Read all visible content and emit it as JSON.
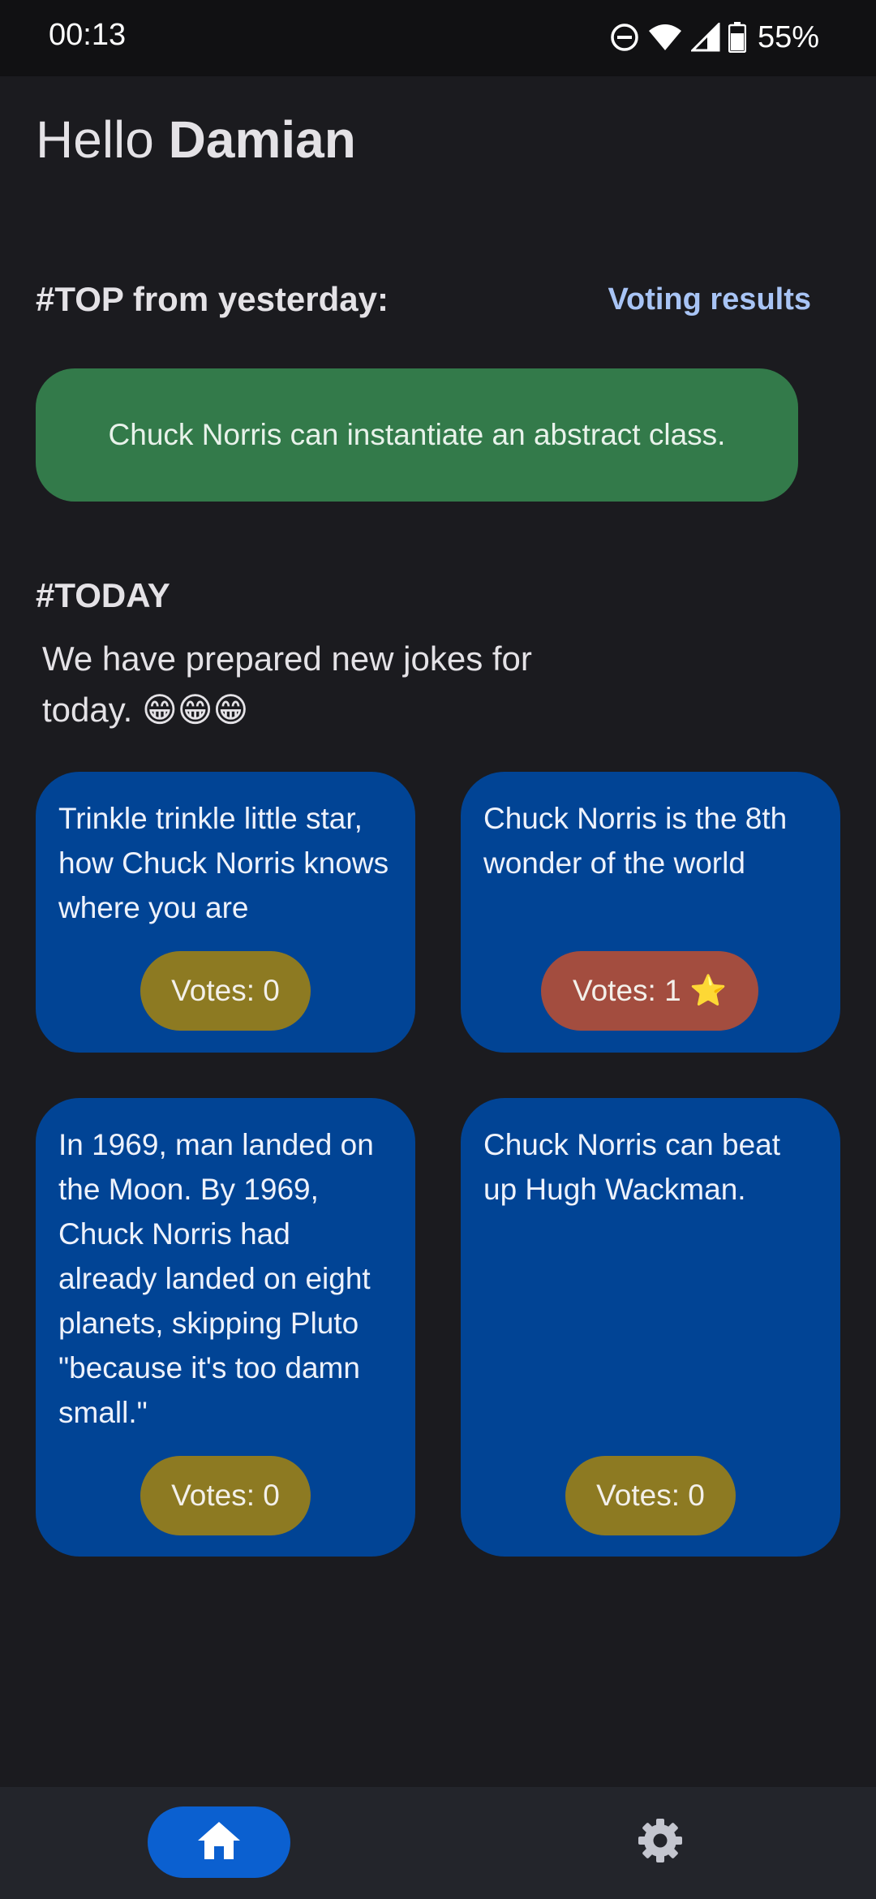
{
  "status_bar": {
    "time": "00:13",
    "battery": "55%",
    "icons": [
      "dnd-icon",
      "wifi-icon",
      "signal-icon",
      "battery-icon"
    ]
  },
  "greeting": {
    "prefix": "Hello ",
    "name": "Damian"
  },
  "top_section": {
    "title": "#TOP from yesterday:",
    "link_label": "Voting results",
    "joke": "Chuck Norris can instantiate an abstract class."
  },
  "today_section": {
    "title": "#TODAY",
    "subtitle": "We have prepared new jokes for today. 😁😁😁"
  },
  "cards": [
    {
      "text": "Trinkle trinkle little star, how Chuck Norris knows where you are",
      "votes_label": "Votes: 0",
      "status": "default"
    },
    {
      "text": "Chuck Norris is the 8th wonder of the world",
      "votes_label": "Votes: 1 ⭐",
      "status": "voted"
    },
    {
      "text": "In 1969, man landed on the Moon. By 1969, Chuck Norris had already landed on eight planets, skipping Pluto \"because it's too damn small.\"",
      "votes_label": "Votes: 0",
      "status": "default"
    },
    {
      "text": "Chuck Norris can beat up Hugh Wackman.",
      "votes_label": "Votes: 0",
      "status": "default"
    }
  ],
  "bottom_nav": {
    "items": [
      {
        "icon": "home-icon",
        "selected": true
      },
      {
        "icon": "gear-icon",
        "selected": false
      }
    ]
  },
  "colors": {
    "background": "#1b1b1f",
    "top_joke": "#337a4a",
    "card": "#014495",
    "vote_default": "#8d7a22",
    "vote_voted": "#a34d3f",
    "link": "#a8c4f5",
    "nav_selected": "#0b60d0"
  }
}
